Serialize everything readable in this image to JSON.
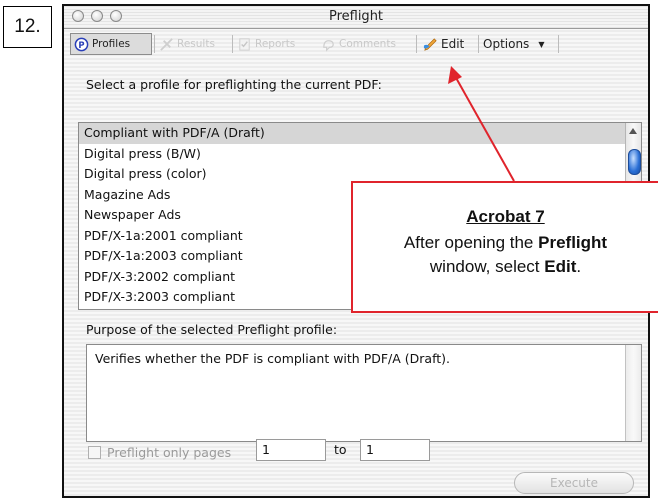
{
  "step": {
    "label": "12."
  },
  "window": {
    "title": "Preflight"
  },
  "toolbar": {
    "profiles": {
      "label": "Profiles",
      "icon": "profiles-icon"
    },
    "results": {
      "label": "Results",
      "icon": "results-icon"
    },
    "reports": {
      "label": "Reports",
      "icon": "reports-icon"
    },
    "comments": {
      "label": "Comments",
      "icon": "comments-icon"
    },
    "edit": {
      "label": "Edit",
      "icon": "edit-icon"
    },
    "options": {
      "label": "Options",
      "icon": "chevron-down-icon"
    }
  },
  "prompt": "Select a profile for preflighting the current PDF:",
  "profiles": [
    "Compliant with PDF/A (Draft)",
    "Digital press (B/W)",
    "Digital press (color)",
    "Magazine Ads",
    "Newspaper Ads",
    "PDF/X-1a:2001 compliant",
    "PDF/X-1a:2003 compliant",
    "PDF/X-3:2002 compliant",
    "PDF/X-3:2003 compliant"
  ],
  "selected_profile_index": 0,
  "purpose": {
    "label": "Purpose of the selected Preflight profile:",
    "text": "Verifies whether the PDF is compliant with PDF/A (Draft)."
  },
  "page_range": {
    "checkbox_label": "Preflight only pages",
    "from_value": "1",
    "to_label": "to",
    "to_value": "1"
  },
  "execute_label": "Execute",
  "callout": {
    "title": "Acrobat 7",
    "line1": "After opening the ",
    "line1_bold": "Preflight",
    "line2": "window, select ",
    "line2_bold": "Edit",
    "line2_end": "."
  },
  "colors": {
    "annotation_red": "#e0242c",
    "selection_gray": "#d6d6d6",
    "scroll_blue": "#2a6fd6"
  }
}
